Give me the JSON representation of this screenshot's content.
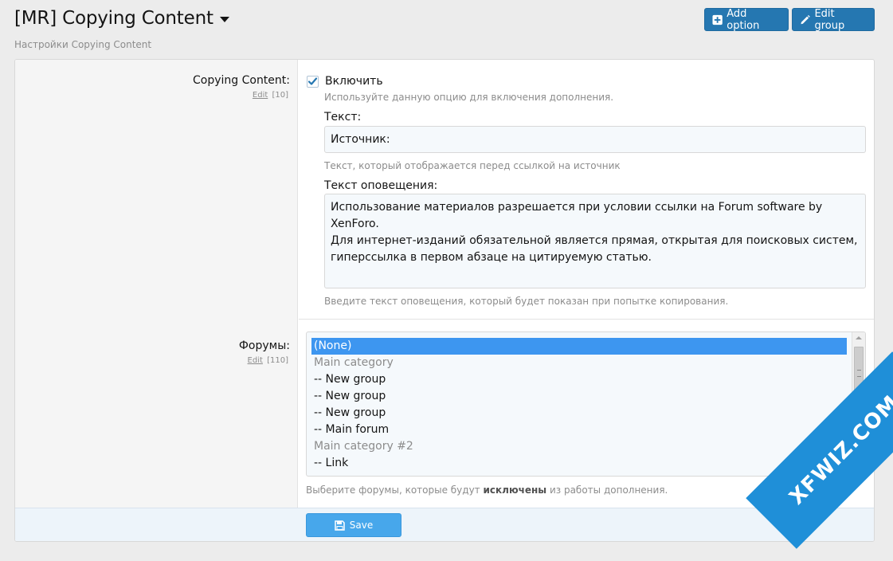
{
  "header": {
    "title": "[MR] Copying Content",
    "description": "Настройки Copying Content",
    "add_option_label": "Add option",
    "edit_group_label": "Edit group"
  },
  "option_copying": {
    "label": "Copying Content:",
    "edit_link": "Edit",
    "order": "[10]",
    "enable_label": "Включить",
    "enable_checked": true,
    "enable_hint": "Используйте данную опцию для включения дополнения.",
    "text_label": "Текст:",
    "text_value": "Источник:",
    "text_hint": "Текст, который отображается перед ссылкой на источник",
    "notice_label": "Текст оповещения:",
    "notice_value": "Использование материалов разрешается при условии ссылки на Forum software by XenForo.\nДля интернет-изданий обязательной является прямая, открытая для поисковых систем,\nгиперссылка в первом абзаце на цитируемую статью.",
    "notice_hint": "Введите текст оповещения, который будет показан при попытке копирования."
  },
  "option_forums": {
    "label": "Форумы:",
    "edit_link": "Edit",
    "order": "[110]",
    "options": [
      {
        "text": "(None)",
        "selected": true,
        "category": false
      },
      {
        "text": "Main category",
        "selected": false,
        "category": true
      },
      {
        "text": "-- New group",
        "selected": false,
        "category": false
      },
      {
        "text": "-- New group",
        "selected": false,
        "category": false
      },
      {
        "text": "-- New group",
        "selected": false,
        "category": false
      },
      {
        "text": "-- Main forum",
        "selected": false,
        "category": false
      },
      {
        "text": "Main category #2",
        "selected": false,
        "category": true
      },
      {
        "text": "-- Link",
        "selected": false,
        "category": false
      }
    ],
    "hint_before": "Выберите форумы, которые будут",
    "hint_bold": "исключены",
    "hint_after": "из работы дополнения."
  },
  "footer": {
    "save_label": "Save"
  },
  "watermark": "XFWIZ.COM",
  "colors": {
    "primary": "#2577b1",
    "save": "#47a7eb",
    "selected_option": "#3d96f0",
    "watermark": "#1f8fd8"
  }
}
